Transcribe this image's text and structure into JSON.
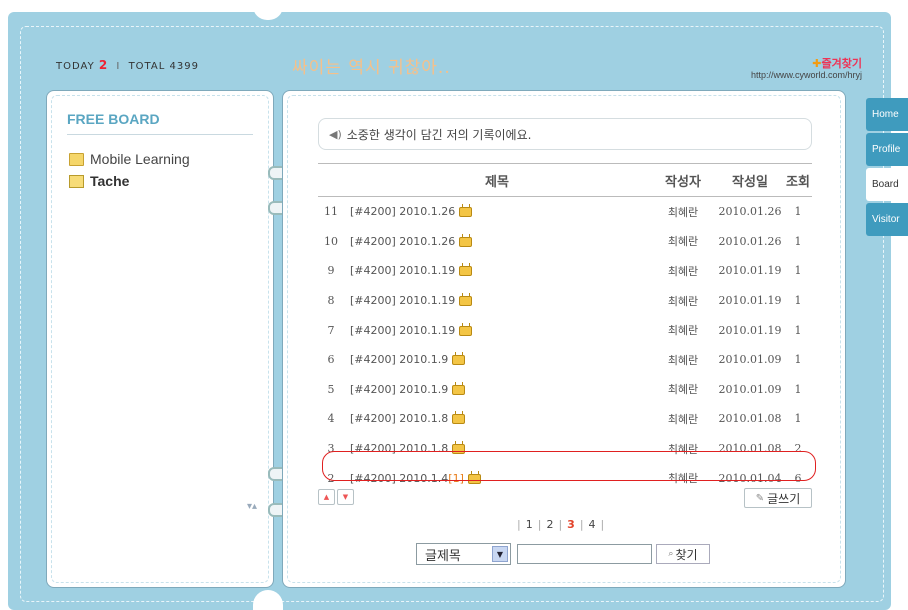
{
  "header": {
    "today_label": "TODAY",
    "today_count": "2",
    "separator": "I",
    "total_label": "TOTAL",
    "total_count": "4399",
    "page_title": "싸이는 역시 귀찮아..",
    "favorites_label": "즐겨찾기",
    "url": "http://www.cyworld.com/hryj"
  },
  "sidebar": {
    "title": "FREE BOARD",
    "items": [
      {
        "label": "Mobile Learning",
        "icon": "folder-icon"
      },
      {
        "label": "Tache",
        "icon": "note-icon"
      }
    ]
  },
  "tabs": [
    {
      "label": "Home",
      "active": false
    },
    {
      "label": "Profile",
      "active": false
    },
    {
      "label": "Board",
      "active": true
    },
    {
      "label": "Visitor",
      "active": false
    }
  ],
  "board": {
    "intro": "소중한 생각이 담긴 저의 기록이에요.",
    "columns": {
      "title": "제목",
      "author": "작성자",
      "date": "작성일",
      "views": "조회"
    },
    "rows": [
      {
        "no": "11",
        "title": "[#4200] 2010.1.26",
        "comments": "",
        "author": "최혜란",
        "date": "2010.01.26",
        "views": "1"
      },
      {
        "no": "10",
        "title": "[#4200] 2010.1.26",
        "comments": "",
        "author": "최혜란",
        "date": "2010.01.26",
        "views": "1"
      },
      {
        "no": "9",
        "title": "[#4200] 2010.1.19",
        "comments": "",
        "author": "최혜란",
        "date": "2010.01.19",
        "views": "1"
      },
      {
        "no": "8",
        "title": "[#4200] 2010.1.19",
        "comments": "",
        "author": "최혜란",
        "date": "2010.01.19",
        "views": "1"
      },
      {
        "no": "7",
        "title": "[#4200] 2010.1.19",
        "comments": "",
        "author": "최혜란",
        "date": "2010.01.19",
        "views": "1"
      },
      {
        "no": "6",
        "title": "[#4200] 2010.1.9",
        "comments": "",
        "author": "최혜란",
        "date": "2010.01.09",
        "views": "1"
      },
      {
        "no": "5",
        "title": "[#4200] 2010.1.9",
        "comments": "",
        "author": "최혜란",
        "date": "2010.01.09",
        "views": "1"
      },
      {
        "no": "4",
        "title": "[#4200] 2010.1.8",
        "comments": "",
        "author": "최혜란",
        "date": "2010.01.08",
        "views": "1"
      },
      {
        "no": "3",
        "title": "[#4200] 2010.1.8",
        "comments": "",
        "author": "최혜란",
        "date": "2010.01.08",
        "views": "2"
      },
      {
        "no": "2",
        "title": "[#4200] 2010.1.4",
        "comments": "[1]",
        "author": "최혜란",
        "date": "2010.01.04",
        "views": "6"
      }
    ],
    "write_label": "글쓰기",
    "pages": [
      "1",
      "2",
      "3",
      "4"
    ],
    "current_page": "3",
    "search": {
      "field_selected": "글제목",
      "query": "",
      "button_label": "찾기"
    },
    "colors": {
      "highlight": "#e02020",
      "tab_blue": "#3f9bbe",
      "frame": "#9fd0e2"
    }
  }
}
